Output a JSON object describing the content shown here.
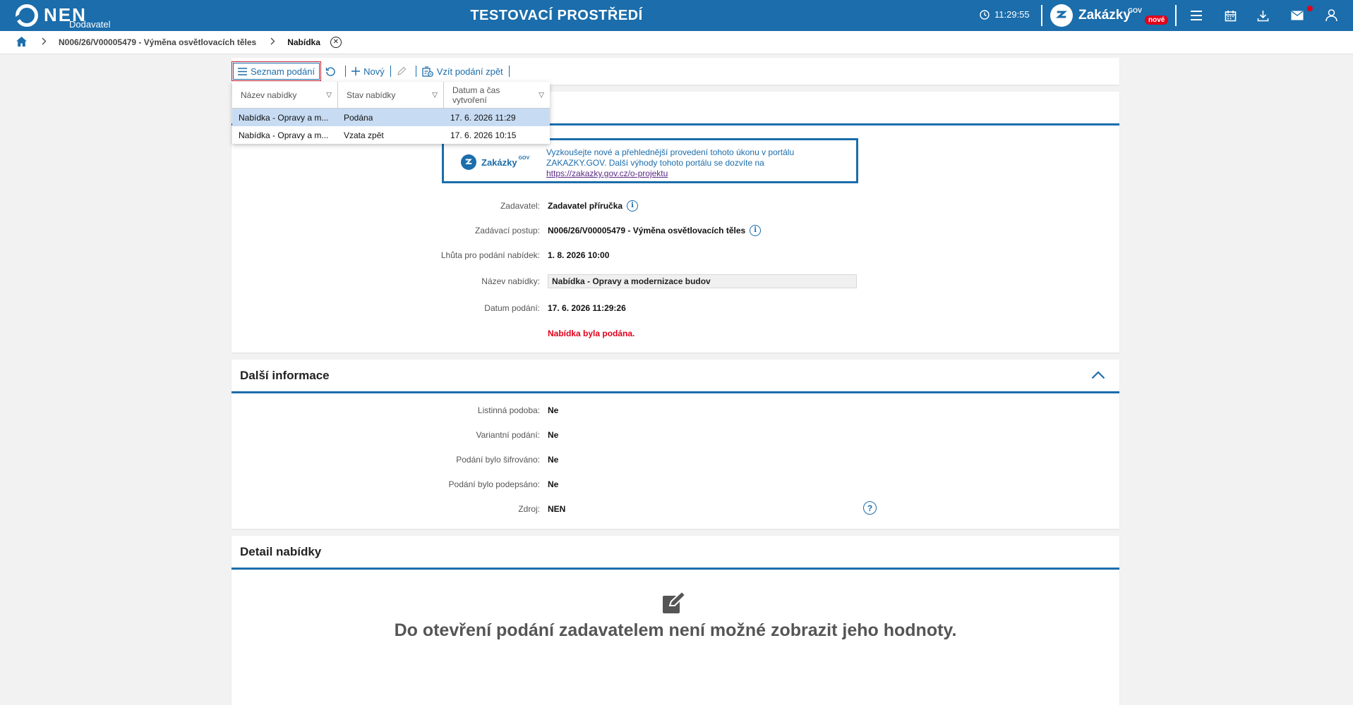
{
  "header": {
    "app_name": "NEN",
    "app_role": "Dodavatel",
    "environment_title": "TESTOVACÍ PROSTŘEDÍ",
    "clock": "11:29:55",
    "zakazky_label": "Zakázky",
    "zakazky_gov": "GOV",
    "zakazky_badge": "nové",
    "icons": [
      "menu-icon",
      "calendar-icon",
      "download-icon",
      "mail-icon",
      "user-icon"
    ],
    "accent_color": "#1b6dab"
  },
  "breadcrumb": {
    "items": [
      "N006/26/V00005479 - Výměna osvětlovacích těles",
      "Nabídka"
    ]
  },
  "toolbar": {
    "list_label": "Seznam podání",
    "new_label": "Nový",
    "withdraw_label": "Vzít podání zpět"
  },
  "dropdown": {
    "columns": [
      "Název nabídky",
      "Stav nabídky",
      "Datum a čas vytvoření"
    ],
    "rows": [
      {
        "name": "Nabídka - Opravy a m...",
        "status": "Podána",
        "created": "17. 6. 2026 11:29"
      },
      {
        "name": "Nabídka - Opravy a m...",
        "status": "Vzata zpět",
        "created": "17. 6. 2026 10:15"
      }
    ]
  },
  "banner": {
    "logo_text": "Zakázky",
    "logo_gov": "GOV",
    "text": "Vyzkoušejte nové a přehlednější provedení tohoto úkonu v portálu ZAKAZKY.GOV. Další výhody tohoto portálu se dozvíte na",
    "link": "https://zakazky.gov.cz/o-projektu"
  },
  "main": {
    "fields": [
      {
        "label": "Zadavatel:",
        "value": "Zadavatel příručka"
      },
      {
        "label": "Zadávací postup:",
        "value": "N006/26/V00005479 - Výměna osvětlovacích těles"
      },
      {
        "label": "Lhůta pro podání nabídek:",
        "value": "1. 8. 2026 10:00"
      },
      {
        "label": "Název nabídky:",
        "value": "Nabídka - Opravy a modernizace budov"
      },
      {
        "label": "Datum podání:",
        "value": "17. 6. 2026 11:29:26"
      }
    ],
    "status_message": "Nabídka byla podána."
  },
  "additional": {
    "title": "Další informace",
    "fields": [
      {
        "label": "Listinná podoba:",
        "value": "Ne"
      },
      {
        "label": "Variantní podání:",
        "value": "Ne"
      },
      {
        "label": "Podání bylo šifrováno:",
        "value": "Ne"
      },
      {
        "label": "Podání bylo podepsáno:",
        "value": "Ne"
      },
      {
        "label": "Zdroj:",
        "value": "NEN"
      }
    ]
  },
  "detail": {
    "title": "Detail nabídky",
    "message": "Do otevření podání zadavatelem není možné zobrazit jeho hodnoty."
  }
}
